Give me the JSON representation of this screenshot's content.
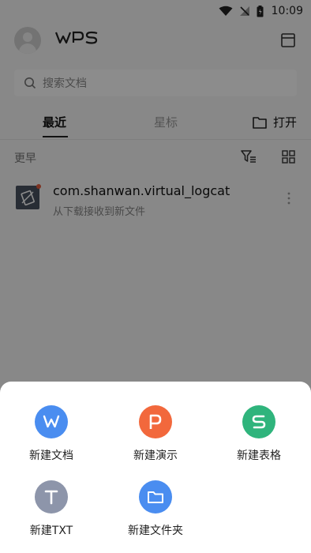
{
  "status_bar": {
    "time": "10:09"
  },
  "header": {
    "logo": "WPS"
  },
  "search": {
    "placeholder": "搜索文档"
  },
  "tabs": {
    "recent": "最近",
    "starred": "星标",
    "open": "打开"
  },
  "section": {
    "title": "更早"
  },
  "files": [
    {
      "name": "com.shanwan.virtual_logcat",
      "source": "从下载接收到新文件"
    }
  ],
  "sheet": {
    "actions": [
      {
        "label": "新建文档",
        "icon": "w-doc-icon",
        "color": "#4a8df0"
      },
      {
        "label": "新建演示",
        "icon": "p-presentation-icon",
        "color": "#f2683c"
      },
      {
        "label": "新建表格",
        "icon": "s-spreadsheet-icon",
        "color": "#2fb47c"
      },
      {
        "label": "新建TXT",
        "icon": "t-text-icon",
        "color": "#8d95aa"
      },
      {
        "label": "新建文件夹",
        "icon": "folder-icon",
        "color": "#4a8df0"
      }
    ]
  }
}
